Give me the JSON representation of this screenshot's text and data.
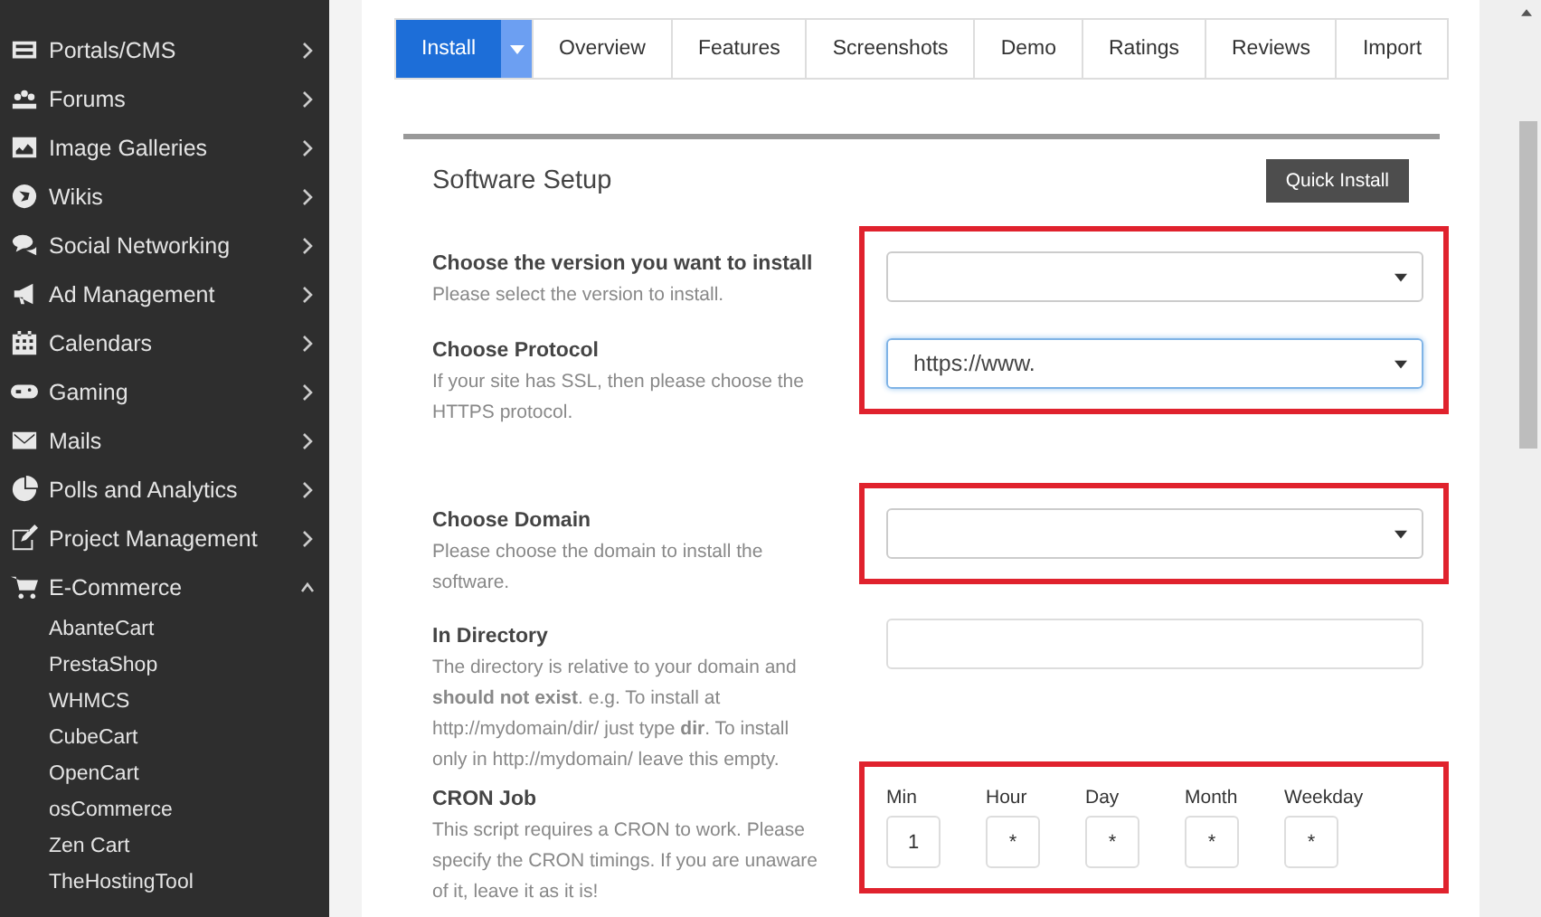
{
  "sidebar": {
    "items": [
      {
        "label": "Portals/CMS",
        "expanded": false
      },
      {
        "label": "Forums",
        "expanded": false
      },
      {
        "label": "Image Galleries",
        "expanded": false
      },
      {
        "label": "Wikis",
        "expanded": false
      },
      {
        "label": "Social Networking",
        "expanded": false
      },
      {
        "label": "Ad Management",
        "expanded": false
      },
      {
        "label": "Calendars",
        "expanded": false
      },
      {
        "label": "Gaming",
        "expanded": false
      },
      {
        "label": "Mails",
        "expanded": false
      },
      {
        "label": "Polls and Analytics",
        "expanded": false
      },
      {
        "label": "Project Management",
        "expanded": false
      },
      {
        "label": "E-Commerce",
        "expanded": true,
        "children": [
          "AbanteCart",
          "PrestaShop",
          "WHMCS",
          "CubeCart",
          "OpenCart",
          "osCommerce",
          "Zen Cart",
          "TheHostingTool"
        ]
      }
    ]
  },
  "tabs": [
    {
      "label": "Install",
      "selected": true,
      "menu": true
    },
    {
      "label": "Overview",
      "selected": false,
      "menu": false
    },
    {
      "label": "Features",
      "selected": false,
      "menu": false
    },
    {
      "label": "Screenshots",
      "selected": false,
      "menu": false
    },
    {
      "label": "Demo",
      "selected": false,
      "menu": false
    },
    {
      "label": "Ratings",
      "selected": false,
      "menu": false
    },
    {
      "label": "Reviews",
      "selected": false,
      "menu": false
    },
    {
      "label": "Import",
      "selected": false,
      "menu": false
    }
  ],
  "setup": {
    "title": "Software Setup",
    "quick_install": "Quick Install",
    "groups": [
      {
        "highlighted": true,
        "fields": [
          {
            "kind": "select",
            "label": "Choose the version you want to install",
            "description": "Please select the version to install.",
            "focused": false
          },
          {
            "kind": "select",
            "label": "Choose Protocol",
            "description": "If your site has SSL, then please choose the HTTPS protocol.",
            "value": "https://www.",
            "focused": true
          }
        ]
      },
      {
        "highlighted": true,
        "fields": [
          {
            "kind": "select",
            "label": "Choose Domain",
            "description": "Please choose the domain to install the software.",
            "focused": false
          }
        ]
      },
      {
        "highlighted": false,
        "fields": [
          {
            "kind": "text",
            "label": "In Directory",
            "description": "The directory is relative to your domain and **should not exist**. e.g. To install at http://mydomain/dir/ just type **dir**. To install only in http://mydomain/ leave this empty."
          }
        ]
      },
      {
        "highlighted": true,
        "fields": [
          {
            "kind": "cron",
            "label": "CRON Job",
            "description": "This script requires a CRON to work. Please specify the CRON timings. If you are unaware of it, leave it as it is!",
            "parts": [
              {
                "label": "Min",
                "value": "1"
              },
              {
                "label": "Hour",
                "value": "*"
              },
              {
                "label": "Day",
                "value": "*"
              },
              {
                "label": "Month",
                "value": "*"
              },
              {
                "label": "Weekday",
                "value": "*"
              }
            ]
          }
        ]
      }
    ]
  }
}
